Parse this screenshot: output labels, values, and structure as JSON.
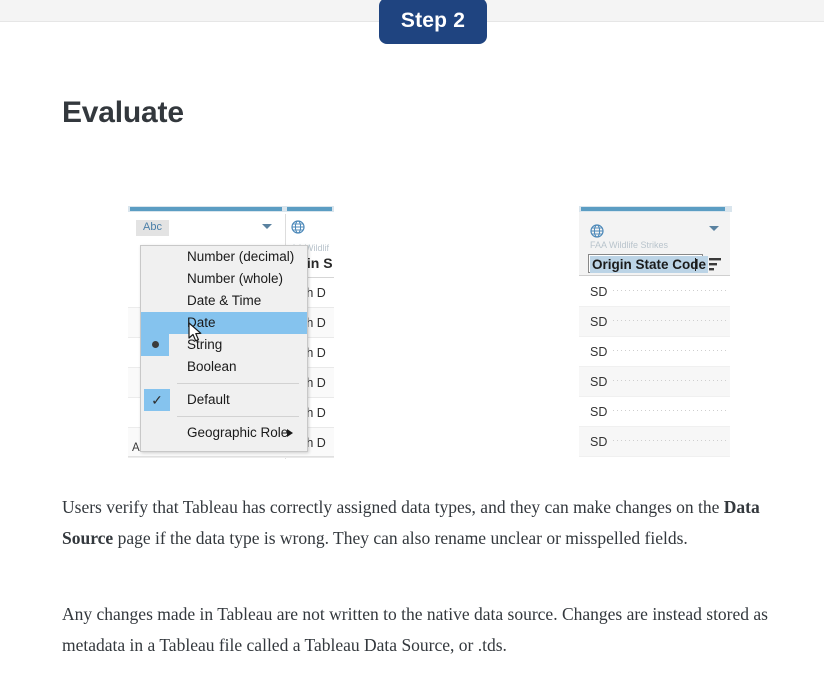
{
  "header": {
    "step_badge": "Step 2"
  },
  "page_title": "Evaluate",
  "left_panel": {
    "type_badge": "Abc",
    "dropdown_caret": "chevron-down",
    "source_name": "AA Wildlif",
    "field_name": "rigin S",
    "last_row_label": "ABERDEEN REGIONA...",
    "rows": [
      "outh D",
      "outh D",
      "outh D",
      "outh D",
      "outh D",
      "outh D"
    ],
    "menu": {
      "items": [
        {
          "label": "Number (decimal)",
          "state": "normal"
        },
        {
          "label": "Number (whole)",
          "state": "normal"
        },
        {
          "label": "Date & Time",
          "state": "normal"
        },
        {
          "label": "Date",
          "state": "highlighted"
        },
        {
          "label": "String",
          "state": "selected-bullet"
        },
        {
          "label": "Boolean",
          "state": "normal"
        },
        {
          "label": "Default",
          "state": "checked"
        },
        {
          "label": "Geographic Role",
          "state": "submenu"
        }
      ]
    }
  },
  "right_panel": {
    "globe_icon": "globe-icon",
    "dropdown_caret": "chevron-down",
    "source_name": "FAA Wildlife Strikes",
    "field_name_value": "Origin State Code",
    "sort_icon": "sort-icon",
    "rows": [
      "SD",
      "SD",
      "SD",
      "SD",
      "SD",
      "SD"
    ]
  },
  "body": {
    "paragraph_1_part_1": "Users verify that Tableau has correctly assigned data types, and they can make changes on the ",
    "paragraph_1_bold": "Data Source",
    "paragraph_1_part_2": " page if the data type is wrong. They can also rename unclear or misspelled fields.",
    "paragraph_2": "Any changes made in Tableau are not written to the native data source. Changes are instead stored as metadata in a Tableau file called a Tableau Data Source, or .tds."
  },
  "colors": {
    "badge_blue": "#1f4480",
    "highlight_blue": "#85c3ee",
    "accent_blue": "#5b9dc3",
    "text_dark": "#33383d"
  }
}
